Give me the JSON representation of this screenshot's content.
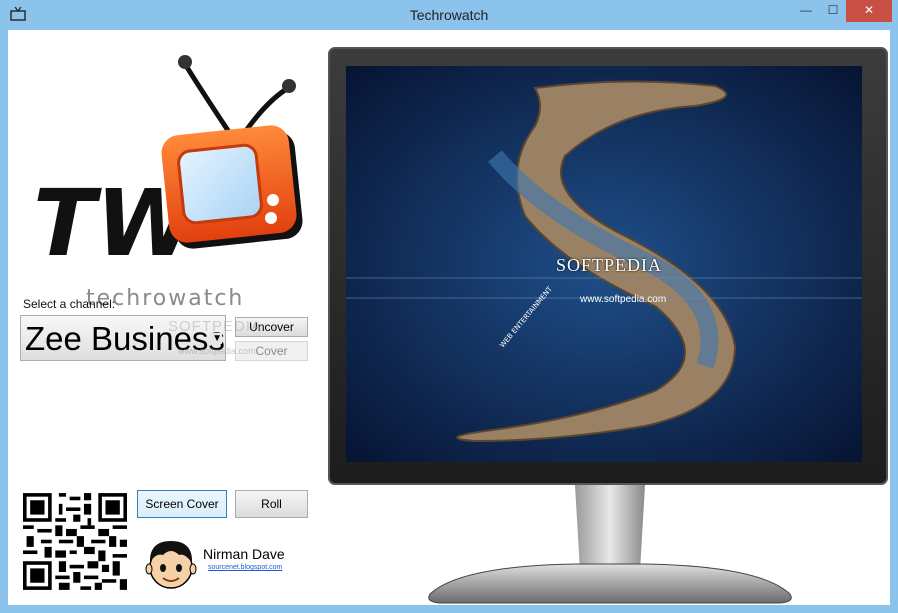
{
  "window": {
    "title": "Techrowatch",
    "controls": {
      "minimize": "—",
      "maximize": "☐",
      "close": "✕"
    }
  },
  "logo": {
    "letters": "TW",
    "subtitle": "techrowatch"
  },
  "channel": {
    "label": "Select a channel:",
    "selected": "Zee Business"
  },
  "buttons": {
    "uncover": "Uncover",
    "cover": "Cover",
    "screen_cover": "Screen Cover",
    "roll": "Roll"
  },
  "author": {
    "name": "Nirman Dave",
    "link": "sourcenet.blogspot.com"
  },
  "screen": {
    "brand": "SOFTPEDIA",
    "url": "www.softpedia.com",
    "tagline": "WEB ENTERTAINMENT"
  },
  "watermark": {
    "text": "SOFTPEDIA",
    "url": "www.softpedia.com"
  },
  "colors": {
    "titlebar": "#8cc3ec",
    "close": "#c74f43",
    "tv_orange": "#f26c22"
  }
}
